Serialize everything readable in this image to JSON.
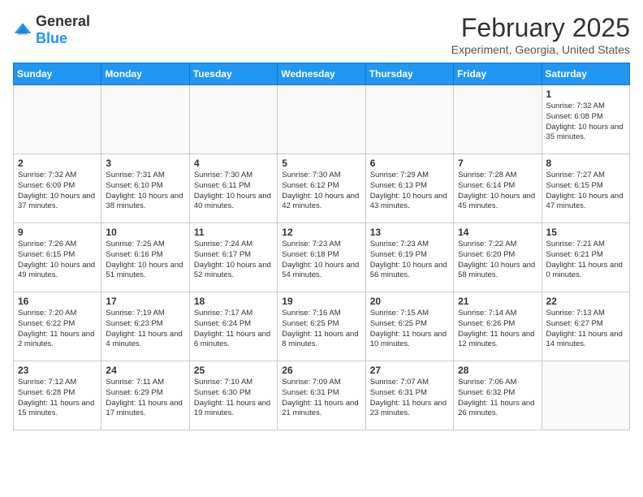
{
  "logo": {
    "general": "General",
    "blue": "Blue"
  },
  "header": {
    "title": "February 2025",
    "subtitle": "Experiment, Georgia, United States"
  },
  "weekdays": [
    "Sunday",
    "Monday",
    "Tuesday",
    "Wednesday",
    "Thursday",
    "Friday",
    "Saturday"
  ],
  "weeks": [
    [
      {
        "day": "",
        "info": ""
      },
      {
        "day": "",
        "info": ""
      },
      {
        "day": "",
        "info": ""
      },
      {
        "day": "",
        "info": ""
      },
      {
        "day": "",
        "info": ""
      },
      {
        "day": "",
        "info": ""
      },
      {
        "day": "1",
        "info": "Sunrise: 7:32 AM\nSunset: 6:08 PM\nDaylight: 10 hours and 35 minutes."
      }
    ],
    [
      {
        "day": "2",
        "info": "Sunrise: 7:32 AM\nSunset: 6:09 PM\nDaylight: 10 hours and 37 minutes."
      },
      {
        "day": "3",
        "info": "Sunrise: 7:31 AM\nSunset: 6:10 PM\nDaylight: 10 hours and 38 minutes."
      },
      {
        "day": "4",
        "info": "Sunrise: 7:30 AM\nSunset: 6:11 PM\nDaylight: 10 hours and 40 minutes."
      },
      {
        "day": "5",
        "info": "Sunrise: 7:30 AM\nSunset: 6:12 PM\nDaylight: 10 hours and 42 minutes."
      },
      {
        "day": "6",
        "info": "Sunrise: 7:29 AM\nSunset: 6:13 PM\nDaylight: 10 hours and 43 minutes."
      },
      {
        "day": "7",
        "info": "Sunrise: 7:28 AM\nSunset: 6:14 PM\nDaylight: 10 hours and 45 minutes."
      },
      {
        "day": "8",
        "info": "Sunrise: 7:27 AM\nSunset: 6:15 PM\nDaylight: 10 hours and 47 minutes."
      }
    ],
    [
      {
        "day": "9",
        "info": "Sunrise: 7:26 AM\nSunset: 6:15 PM\nDaylight: 10 hours and 49 minutes."
      },
      {
        "day": "10",
        "info": "Sunrise: 7:25 AM\nSunset: 6:16 PM\nDaylight: 10 hours and 51 minutes."
      },
      {
        "day": "11",
        "info": "Sunrise: 7:24 AM\nSunset: 6:17 PM\nDaylight: 10 hours and 52 minutes."
      },
      {
        "day": "12",
        "info": "Sunrise: 7:23 AM\nSunset: 6:18 PM\nDaylight: 10 hours and 54 minutes."
      },
      {
        "day": "13",
        "info": "Sunrise: 7:23 AM\nSunset: 6:19 PM\nDaylight: 10 hours and 56 minutes."
      },
      {
        "day": "14",
        "info": "Sunrise: 7:22 AM\nSunset: 6:20 PM\nDaylight: 10 hours and 58 minutes."
      },
      {
        "day": "15",
        "info": "Sunrise: 7:21 AM\nSunset: 6:21 PM\nDaylight: 11 hours and 0 minutes."
      }
    ],
    [
      {
        "day": "16",
        "info": "Sunrise: 7:20 AM\nSunset: 6:22 PM\nDaylight: 11 hours and 2 minutes."
      },
      {
        "day": "17",
        "info": "Sunrise: 7:19 AM\nSunset: 6:23 PM\nDaylight: 11 hours and 4 minutes."
      },
      {
        "day": "18",
        "info": "Sunrise: 7:17 AM\nSunset: 6:24 PM\nDaylight: 11 hours and 6 minutes."
      },
      {
        "day": "19",
        "info": "Sunrise: 7:16 AM\nSunset: 6:25 PM\nDaylight: 11 hours and 8 minutes."
      },
      {
        "day": "20",
        "info": "Sunrise: 7:15 AM\nSunset: 6:25 PM\nDaylight: 11 hours and 10 minutes."
      },
      {
        "day": "21",
        "info": "Sunrise: 7:14 AM\nSunset: 6:26 PM\nDaylight: 11 hours and 12 minutes."
      },
      {
        "day": "22",
        "info": "Sunrise: 7:13 AM\nSunset: 6:27 PM\nDaylight: 11 hours and 14 minutes."
      }
    ],
    [
      {
        "day": "23",
        "info": "Sunrise: 7:12 AM\nSunset: 6:28 PM\nDaylight: 11 hours and 15 minutes."
      },
      {
        "day": "24",
        "info": "Sunrise: 7:11 AM\nSunset: 6:29 PM\nDaylight: 11 hours and 17 minutes."
      },
      {
        "day": "25",
        "info": "Sunrise: 7:10 AM\nSunset: 6:30 PM\nDaylight: 11 hours and 19 minutes."
      },
      {
        "day": "26",
        "info": "Sunrise: 7:09 AM\nSunset: 6:31 PM\nDaylight: 11 hours and 21 minutes."
      },
      {
        "day": "27",
        "info": "Sunrise: 7:07 AM\nSunset: 6:31 PM\nDaylight: 11 hours and 23 minutes."
      },
      {
        "day": "28",
        "info": "Sunrise: 7:06 AM\nSunset: 6:32 PM\nDaylight: 11 hours and 26 minutes."
      },
      {
        "day": "",
        "info": ""
      }
    ]
  ]
}
